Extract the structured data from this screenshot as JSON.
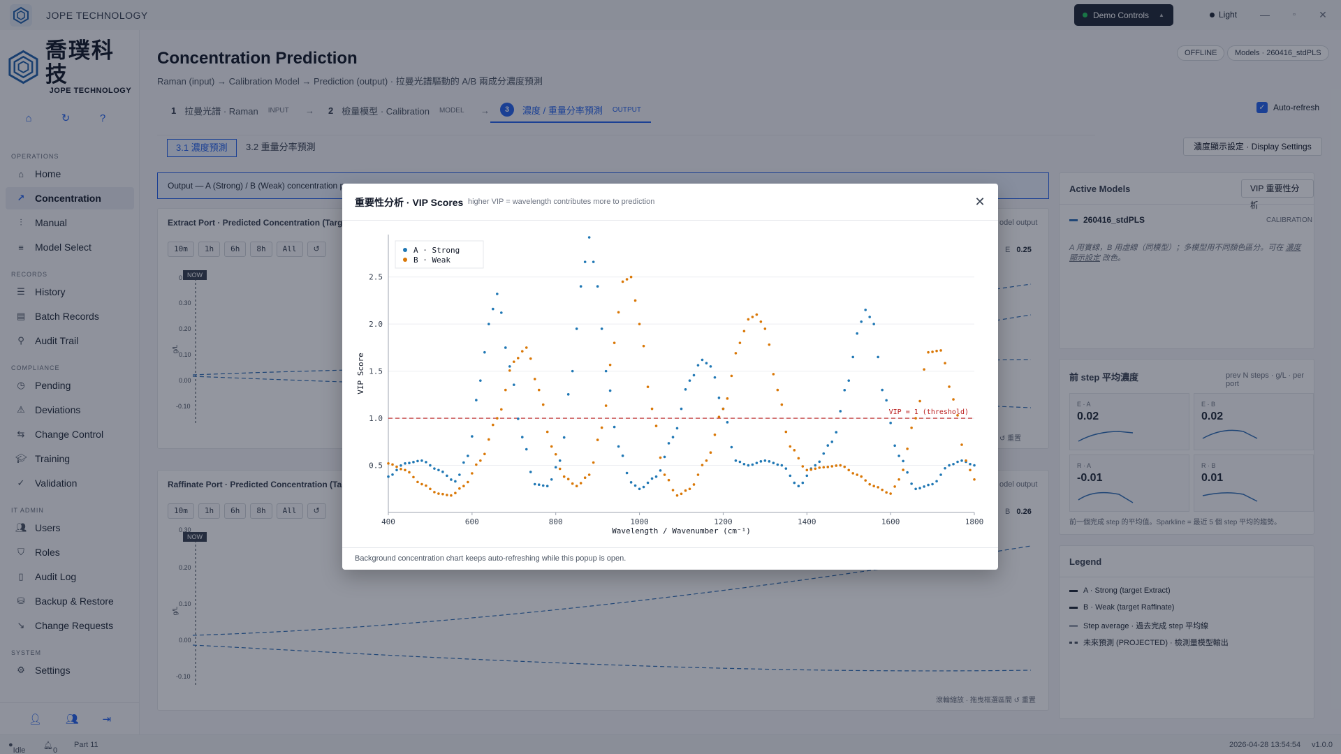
{
  "titlebar": {
    "app_name": "JOPE TECHNOLOGY",
    "demo_label": "Demo Controls",
    "theme_label": "Light"
  },
  "brand": {
    "cjk": "喬璞科技",
    "en": "JOPE TECHNOLOGY"
  },
  "sidebar": {
    "sections": {
      "operations": "OPERATIONS",
      "records": "RECORDS",
      "compliance": "COMPLIANCE",
      "it_admin": "IT ADMIN",
      "system": "SYSTEM"
    },
    "items": {
      "home": "Home",
      "concentration": "Concentration",
      "manual": "Manual",
      "model_select": "Model Select",
      "history": "History",
      "batch_records": "Batch Records",
      "audit_trail": "Audit Trail",
      "pending": "Pending",
      "deviations": "Deviations",
      "change_control": "Change Control",
      "training": "Training",
      "validation": "Validation",
      "users": "Users",
      "roles": "Roles",
      "audit_log": "Audit Log",
      "backup_restore": "Backup & Restore",
      "change_requests": "Change Requests",
      "settings": "Settings"
    }
  },
  "header": {
    "title": "Concentration Prediction",
    "subtitle": "Raman (input) → Calibration Model → Prediction (output) · 拉曼光譜驅動的 A/B 兩成分濃度預測",
    "status_pill": "OFFLINE",
    "models_pill": "Models · 260416_stdPLS"
  },
  "steps": [
    {
      "num": "1",
      "label": "拉曼光譜 · Raman",
      "tag": "INPUT"
    },
    {
      "num": "2",
      "label": "檢量模型 · Calibration",
      "tag": "MODEL"
    },
    {
      "num": "3",
      "label": "濃度 / 重量分率預測",
      "tag": "OUTPUT"
    }
  ],
  "auto_refresh": "Auto-refresh",
  "subtabs": {
    "t1": "3.1 濃度預測",
    "t2": "3.2 重量分率預測"
  },
  "display_settings": "濃度顯示設定 · Display Settings",
  "banner": "Output — A (Strong) / B (Weak) concentration pr",
  "extract_panel": {
    "title": "Extract Port · Predicted Concentration (Targ",
    "right_note": "odel output",
    "value_label": "E",
    "value": "0.25",
    "yticks": [
      "0",
      "0.30",
      "0.20",
      "0.10",
      "0.00",
      "-0.10"
    ],
    "unit": "g/L",
    "footer": "重置"
  },
  "raffinate_panel": {
    "title": "Raffinate Port · Predicted Concentration (Ta",
    "right_note": "odel output",
    "value_label": "B",
    "value": "0.26",
    "yticks": [
      "0.30",
      "0.20",
      "0.10",
      "0.00",
      "-0.10"
    ],
    "unit": "g/L",
    "footer_hint": "滾輪縮放 · 拖曳框選區間",
    "footer_reset": "重置"
  },
  "ranges": [
    "10m",
    "1h",
    "6h",
    "8h",
    "All"
  ],
  "now_label": "NOW",
  "active_models": {
    "title": "Active Models",
    "vip_button": "VIP 重要性分析",
    "model_name": "260416_stdPLS",
    "model_tag": "CALIBRATION",
    "note_prefix": "A 用實線，B 用虛線（同模型）；多模型用不同顏色區分。可在 ",
    "note_em": "濃度顯示設定",
    "note_suffix": " 改色。"
  },
  "step_avg": {
    "title": "前 step 平均濃度",
    "subtitle": "prev N steps · g/L · per port",
    "cards": [
      {
        "label": "E · A",
        "value": "0.02"
      },
      {
        "label": "E · B",
        "value": "0.02"
      },
      {
        "label": "R · A",
        "value": "-0.01"
      },
      {
        "label": "R · B",
        "value": "0.01"
      }
    ],
    "note": "前一個完成 step 的平均值。Sparkline = 最近 5 個 step 平均的趨勢。"
  },
  "legend": {
    "title": "Legend",
    "items": [
      "A · Strong (target Extract)",
      "B · Weak (target Raffinate)",
      "Step average · 過去完成 step 平均線",
      "未來預測 (PROJECTED) · 檢測量模型輸出"
    ]
  },
  "statusbar": {
    "state": "Idle",
    "alerts": "0",
    "part": "Part 11",
    "datetime": "2026-04-28 13:54:54",
    "version": "v1.0.0"
  },
  "modal": {
    "title": "重要性分析 · VIP Scores",
    "subtitle": "higher VIP = wavelength contributes more to prediction",
    "footer": "Background concentration chart keeps auto-refreshing while this popup is open.",
    "threshold_label": "VIP = 1 (threshold)"
  },
  "colors": {
    "accent": "#2563eb",
    "series_a": "#1f77b4",
    "series_b": "#d97706",
    "threshold": "#b91c1c"
  },
  "chart_data": {
    "type": "scatter",
    "xlabel": "Wavelength / Wavenumber (cm⁻¹)",
    "ylabel": "VIP Score",
    "xlim": [
      400,
      1800
    ],
    "ylim": [
      0,
      2.95
    ],
    "xticks": [
      400,
      600,
      800,
      1000,
      1200,
      1400,
      1600,
      1800
    ],
    "yticks": [
      0.5,
      1.0,
      1.5,
      2.0,
      2.5
    ],
    "ytick_labels": [
      "0.5",
      "1.0",
      "1.5",
      "2.0",
      "2.5"
    ],
    "threshold": 1.0,
    "legend_position": "top-left",
    "grid": true,
    "series": [
      {
        "name": "A · Strong",
        "color": "#1f77b4",
        "x": [
          400,
          440,
          480,
          520,
          560,
          590,
          620,
          640,
          660,
          690,
          720,
          750,
          780,
          810,
          840,
          860,
          880,
          900,
          920,
          950,
          980,
          1000,
          1040,
          1080,
          1120,
          1150,
          1170,
          1200,
          1230,
          1260,
          1300,
          1340,
          1380,
          1420,
          1460,
          1500,
          1520,
          1540,
          1560,
          1580,
          1620,
          1660,
          1700,
          1740,
          1770,
          1800
        ],
        "y": [
          0.38,
          0.52,
          0.55,
          0.45,
          0.33,
          0.6,
          1.4,
          2.0,
          2.32,
          1.55,
          0.8,
          0.3,
          0.28,
          0.55,
          1.5,
          2.4,
          2.92,
          2.4,
          1.5,
          0.7,
          0.32,
          0.25,
          0.38,
          0.8,
          1.4,
          1.62,
          1.55,
          1.1,
          0.55,
          0.5,
          0.55,
          0.5,
          0.28,
          0.5,
          0.75,
          1.4,
          1.9,
          2.15,
          2.0,
          1.3,
          0.6,
          0.25,
          0.3,
          0.5,
          0.55,
          0.5
        ]
      },
      {
        "name": "B · Weak",
        "color": "#d97706",
        "x": [
          400,
          440,
          480,
          520,
          550,
          580,
          620,
          660,
          700,
          730,
          760,
          790,
          820,
          850,
          880,
          910,
          940,
          960,
          980,
          1000,
          1030,
          1060,
          1090,
          1120,
          1160,
          1200,
          1240,
          1260,
          1280,
          1300,
          1330,
          1360,
          1400,
          1440,
          1480,
          1520,
          1560,
          1600,
          1620,
          1660,
          1690,
          1720,
          1750,
          1780,
          1800
        ],
        "y": [
          0.52,
          0.45,
          0.3,
          0.2,
          0.18,
          0.28,
          0.55,
          1.0,
          1.6,
          1.75,
          1.3,
          0.7,
          0.38,
          0.28,
          0.4,
          0.9,
          1.8,
          2.45,
          2.5,
          2.0,
          1.1,
          0.4,
          0.18,
          0.25,
          0.55,
          1.1,
          1.8,
          2.05,
          2.1,
          1.95,
          1.3,
          0.7,
          0.45,
          0.48,
          0.5,
          0.4,
          0.28,
          0.2,
          0.35,
          1.0,
          1.7,
          1.72,
          1.2,
          0.55,
          0.35
        ]
      }
    ]
  }
}
